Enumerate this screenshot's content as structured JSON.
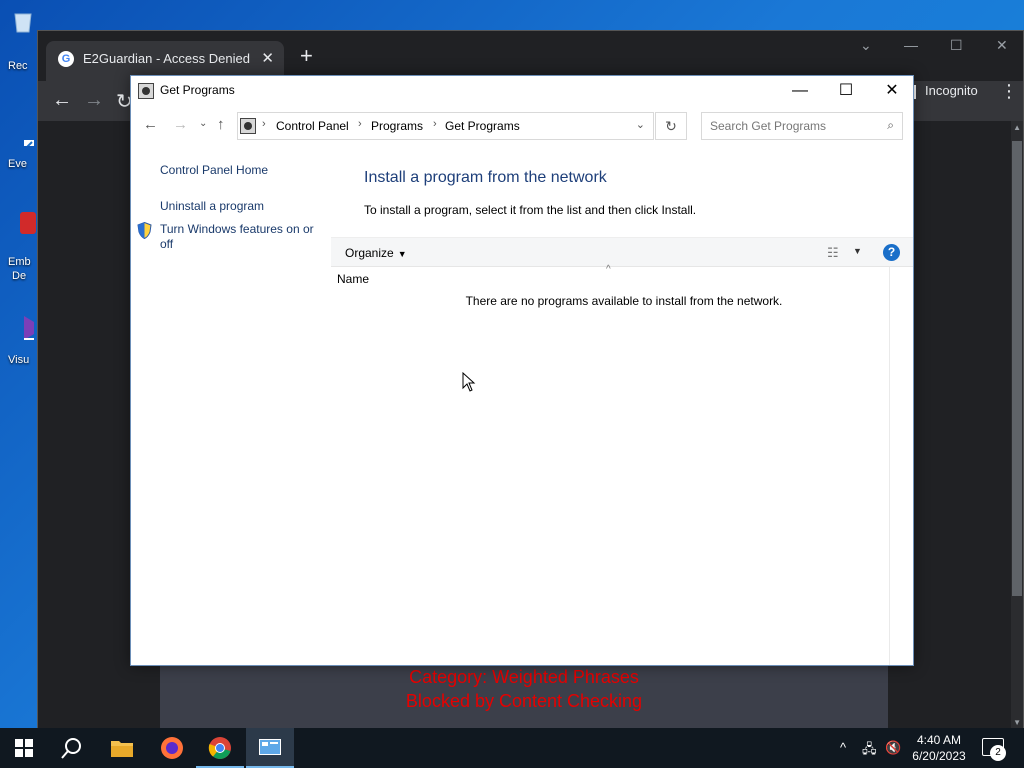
{
  "desktop": {
    "icons": [
      {
        "label": "Rec"
      },
      {
        "label": "Eve"
      },
      {
        "label": "Emb",
        "label2": "De"
      },
      {
        "label": "Visu"
      }
    ]
  },
  "chrome": {
    "tab_title": "E2Guardian - Access Denied",
    "incognito_label": "Incognito",
    "block_line1": "Category: Weighted Phrases",
    "block_line2": "Blocked by Content Checking"
  },
  "window": {
    "title": "Get Programs",
    "breadcrumb": [
      "Control Panel",
      "Programs",
      "Get Programs"
    ],
    "search_placeholder": "Search Get Programs",
    "left_links": [
      "Control Panel Home",
      "Uninstall a program",
      "Turn Windows features on or",
      "off"
    ],
    "heading": "Install a program from the network",
    "description": "To install a program, select it from the list and then click Install.",
    "organize_label": "Organize",
    "column_name": "Name",
    "empty_message": "There are no programs available to install from the network."
  },
  "taskbar": {
    "time": "4:40 AM",
    "date": "6/20/2023",
    "notification_count": "2"
  },
  "colors": {
    "accent": "#1a6fc9",
    "heading": "#1e3f7a",
    "block_text": "#e60000"
  }
}
